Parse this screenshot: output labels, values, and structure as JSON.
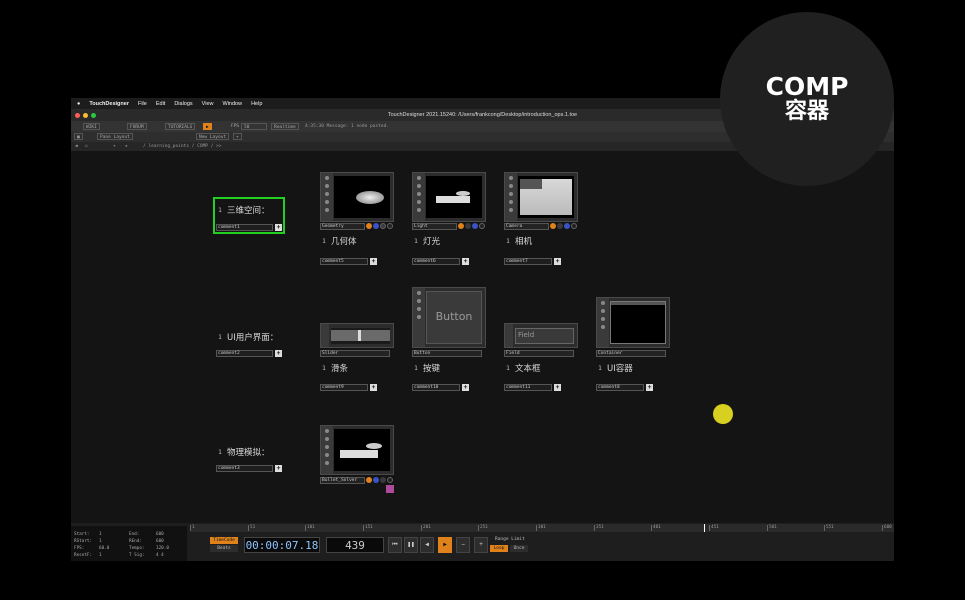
{
  "badge": {
    "line1": "COMP",
    "line2": "容器"
  },
  "menubar": {
    "app": "TouchDesigner",
    "items": [
      "File",
      "Edit",
      "Dialogs",
      "View",
      "Window",
      "Help"
    ]
  },
  "window": {
    "title": "TouchDesigner 2021.15240: /Users/frankcong/Desktop/introduction_ops.1.toe"
  },
  "toolbar": {
    "wiki": "WIKI",
    "forum": "FORUM",
    "tutorials": "TUTORIALS",
    "fps_label": "FPS",
    "fps_value": "50",
    "realtime": "Realtime",
    "message": "4:35:30 Message: 1 node pasted.",
    "pane_layout": "Pane Layout",
    "new_layout": "New Layout"
  },
  "path": {
    "value": "/ learning_points / COMP / >>"
  },
  "rows": [
    {
      "label": "三维空间：",
      "comment": "comment1"
    },
    {
      "label": "UI用户界面：",
      "comment": "comment2"
    },
    {
      "label": "物理模拟：",
      "comment": "comment3"
    }
  ],
  "operators": [
    {
      "name": "Geometry",
      "caption": "几何体",
      "comment": "comment5"
    },
    {
      "name": "Light",
      "caption": "灯光",
      "comment": "comment6"
    },
    {
      "name": "Camera",
      "caption": "相机",
      "comment": "comment7"
    },
    {
      "name": "Slider",
      "caption": "滑条",
      "comment": "comment9"
    },
    {
      "name": "Button",
      "caption": "按键",
      "comment": "comment10",
      "view_text": "Button"
    },
    {
      "name": "Field",
      "caption": "文本框",
      "comment": "comment11",
      "view_text": "Field"
    },
    {
      "name": "Container",
      "caption": "UI容器",
      "comment": "comment8"
    },
    {
      "name": "Bullet_Solver",
      "caption": "",
      "comment": ""
    }
  ],
  "line_number": "1",
  "stats": {
    "start_label": "Start:",
    "start": "1",
    "end_label": "End:",
    "end": "600",
    "rstart_label": "RStart:",
    "rstart": "1",
    "rend_label": "REnd:",
    "rend": "600",
    "fps_label": "FPS:",
    "fps": "60.0",
    "tempo_label": "Tempo:",
    "tempo": "120.0",
    "resetf_label": "ResetF:",
    "resetf": "1",
    "tsig_label": "T Sig:",
    "tsig": "4  4"
  },
  "timeline": {
    "ticks": [
      "1",
      "51",
      "101",
      "151",
      "201",
      "251",
      "301",
      "351",
      "401",
      "451",
      "501",
      "551",
      "600"
    ]
  },
  "playback": {
    "timecode_label": "TimeCode",
    "beats_label": "Beats",
    "timecode": "00:00:07.18",
    "frame": "439",
    "range_limit": "Range Limit",
    "loop": "Loop",
    "once": "Once"
  },
  "colors": {
    "selected_border": "#22d022",
    "accent_orange": "#e0821c",
    "timecode_blue": "#8ec4ff"
  }
}
